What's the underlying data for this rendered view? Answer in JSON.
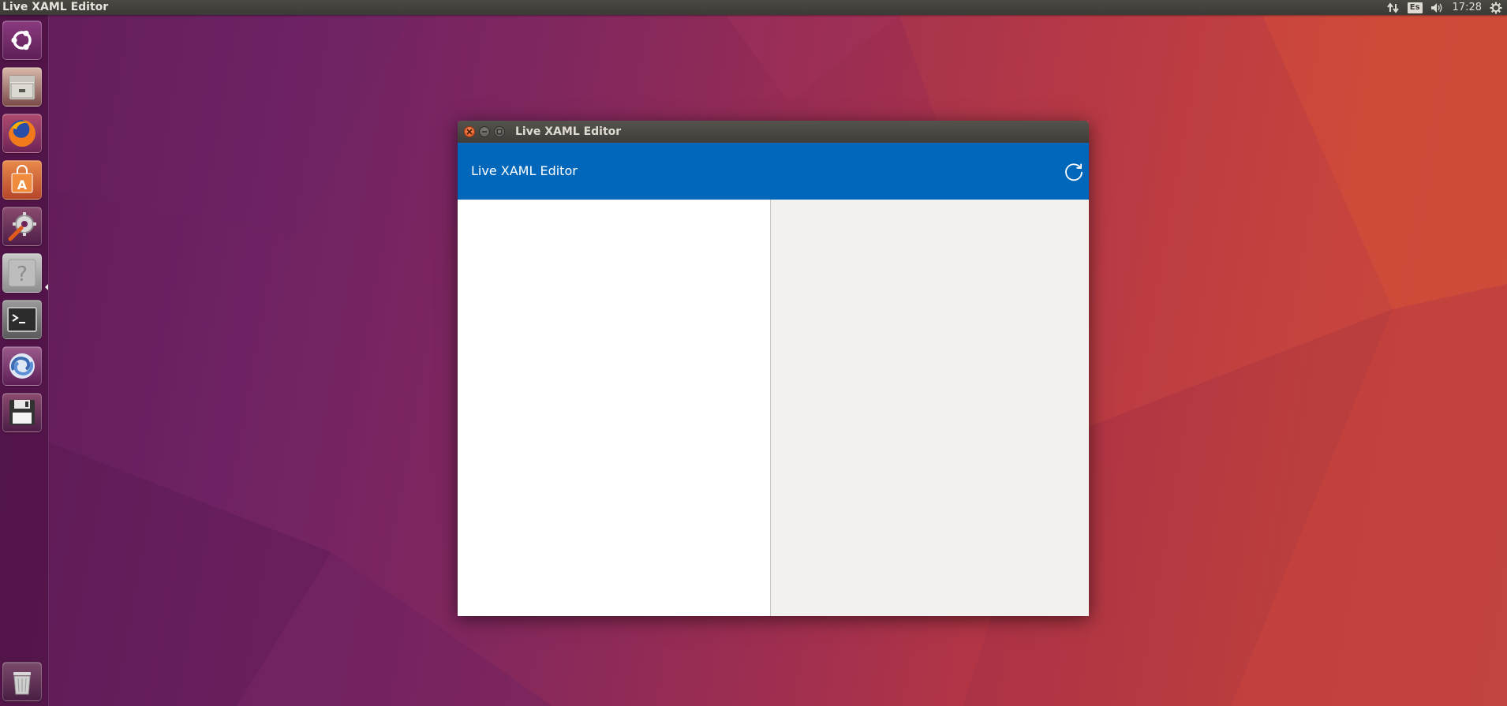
{
  "top_panel": {
    "app_title": "Live XAML Editor",
    "keyboard_layout": "Es",
    "clock": "17:28",
    "icons": [
      "network-icon",
      "keyboard-layout-indicator",
      "volume-icon",
      "session-gear-icon"
    ]
  },
  "launcher": {
    "items": [
      {
        "name": "dash-home",
        "icon": "ubuntu-logo-icon",
        "color": "#7a2a6e"
      },
      {
        "name": "files",
        "icon": "file-cabinet-icon",
        "color": "#d9d5cf"
      },
      {
        "name": "firefox",
        "icon": "firefox-icon",
        "color": "#e66000"
      },
      {
        "name": "software-center",
        "icon": "shopping-bag-icon",
        "color": "#e4722a"
      },
      {
        "name": "system-settings",
        "icon": "wrench-gear-icon",
        "color": "#6a6a6a"
      },
      {
        "name": "help",
        "icon": "question-mark-icon",
        "color": "#bdbdbd"
      },
      {
        "name": "terminal",
        "icon": "terminal-icon",
        "color": "#2c2c2c"
      },
      {
        "name": "app-chain",
        "icon": "chain-link-icon",
        "color": "#4a6fa5"
      },
      {
        "name": "save-app",
        "icon": "floppy-disk-icon",
        "color": "#3a3a3a"
      },
      {
        "name": "trash",
        "icon": "trash-icon",
        "color": "#6b6b6b"
      }
    ]
  },
  "window": {
    "title": "Live XAML Editor",
    "header_title": "Live XAML Editor",
    "accent_color": "#0067bb",
    "buttons": [
      "close-icon",
      "minimize-icon",
      "maximize-icon",
      "refresh-icon"
    ]
  }
}
